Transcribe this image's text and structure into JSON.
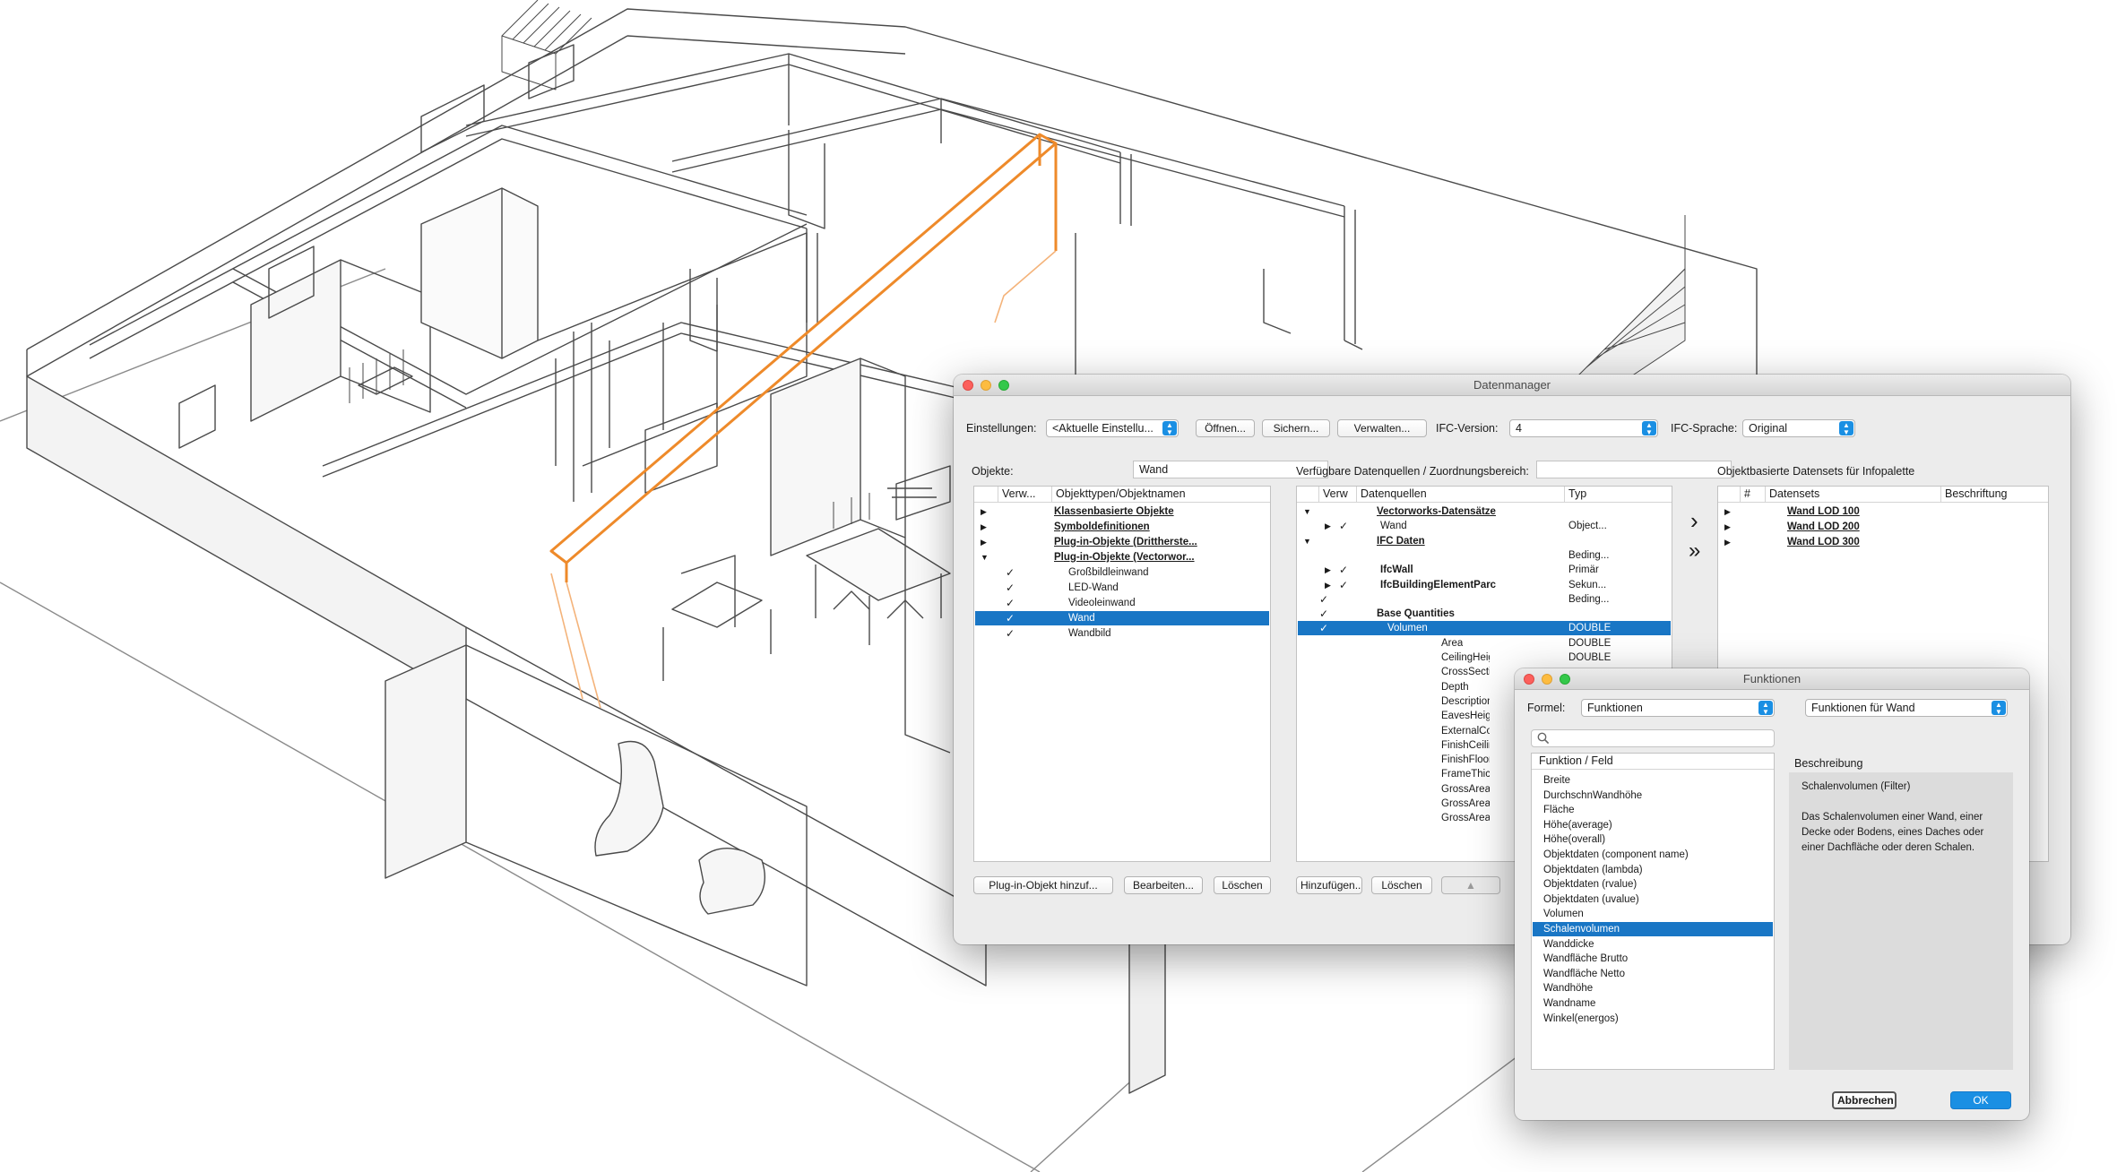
{
  "datenmanager": {
    "title": "Datenmanager",
    "einstellungen_label": "Einstellungen:",
    "einstellungen_value": "<Aktuelle Einstellu...",
    "oeffnen": "Öffnen...",
    "sichern": "Sichern...",
    "verwalten": "Verwalten...",
    "ifc_version_label": "IFC-Version:",
    "ifc_version_value": "4",
    "ifc_sprache_label": "IFC-Sprache:",
    "ifc_sprache_value": "Original",
    "objekte_label": "Objekte:",
    "objekte_filter": "Wand",
    "datenquellen_label": "Verfügbare Datenquellen / Zuordnungsbereich:",
    "datasets_label": "Objektbasierte Datensets für Infopalette",
    "objects_list": {
      "headers": [
        "Verw...",
        "Objekttypen/Objektnamen"
      ],
      "rows": [
        {
          "tri": "▶",
          "check": "",
          "name": "Klassenbasierte Objekte",
          "style": "u",
          "indent": 0
        },
        {
          "tri": "▶",
          "check": "",
          "name": "Symboldefinitionen",
          "style": "u",
          "indent": 0
        },
        {
          "tri": "▶",
          "check": "",
          "name": "Plug-in-Objekte (Drittherste...",
          "style": "u",
          "indent": 0
        },
        {
          "tri": "▼",
          "check": "",
          "name": "Plug-in-Objekte (Vectorwor...",
          "style": "u",
          "indent": 0
        },
        {
          "tri": "",
          "check": "✓",
          "name": "Großbildleinwand",
          "style": "",
          "indent": 1
        },
        {
          "tri": "",
          "check": "✓",
          "name": "LED-Wand",
          "style": "",
          "indent": 1
        },
        {
          "tri": "",
          "check": "✓",
          "name": "Videoleinwand",
          "style": "",
          "indent": 1
        },
        {
          "tri": "",
          "check": "✓",
          "name": "Wand",
          "style": "",
          "indent": 1,
          "selected": true
        },
        {
          "tri": "",
          "check": "✓",
          "name": "Wandbild",
          "style": "",
          "indent": 1
        }
      ]
    },
    "sources_list": {
      "headers": [
        "Verw",
        "Datenquellen",
        "Typ"
      ],
      "rows": [
        {
          "tri": "▼",
          "tri2": "",
          "check": "",
          "name": "Vectorworks-Datensätze",
          "style": "u",
          "type": "",
          "indent": 0
        },
        {
          "tri": "",
          "tri2": "▶",
          "check": "✓",
          "name": "Wand",
          "style": "",
          "type": "Object...",
          "indent": 1
        },
        {
          "tri": "▼",
          "tri2": "",
          "check": "",
          "name": "IFC Daten",
          "style": "u",
          "type": "",
          "indent": 0
        },
        {
          "tri": "",
          "tri2": "",
          "check": "",
          "name": "",
          "style": "",
          "type": "Beding...",
          "indent": 1
        },
        {
          "tri": "",
          "tri2": "▶",
          "check": "✓",
          "name": "IfcWall",
          "style": "b",
          "type": "Primär",
          "indent": 1
        },
        {
          "tri": "",
          "tri2": "▶",
          "check": "✓",
          "name": "IfcBuildingElementParc",
          "style": "b",
          "type": "Sekun...",
          "indent": 1
        },
        {
          "tri": "",
          "tri2": "",
          "check": "✓",
          "name": "",
          "style": "",
          "type": "Beding...",
          "indent": 1
        },
        {
          "tri": "",
          "tri2": "",
          "check": "✓",
          "name": "Base Quantities",
          "style": "b",
          "type": "",
          "indent": 2
        },
        {
          "tri": "",
          "tri2": "",
          "check": "✓",
          "name": "Volumen",
          "style": "",
          "type": "DOUBLE",
          "indent": 3,
          "selected": true
        },
        {
          "tri": "",
          "tri2": "",
          "check": "",
          "name": "Area",
          "style": "",
          "type": "DOUBLE",
          "indent": 4
        },
        {
          "tri": "",
          "tri2": "",
          "check": "",
          "name": "CeilingHeight",
          "style": "",
          "type": "DOUBLE",
          "indent": 4
        },
        {
          "tri": "",
          "tri2": "",
          "check": "",
          "name": "CrossSecti",
          "style": "",
          "type": "",
          "indent": 4
        },
        {
          "tri": "",
          "tri2": "",
          "check": "",
          "name": "Depth",
          "style": "",
          "type": "",
          "indent": 4
        },
        {
          "tri": "",
          "tri2": "",
          "check": "",
          "name": "Description",
          "style": "",
          "type": "",
          "indent": 4
        },
        {
          "tri": "",
          "tri2": "",
          "check": "",
          "name": "EavesHeig",
          "style": "",
          "type": "",
          "indent": 4
        },
        {
          "tri": "",
          "tri2": "",
          "check": "",
          "name": "ExternalCo",
          "style": "",
          "type": "",
          "indent": 4
        },
        {
          "tri": "",
          "tri2": "",
          "check": "",
          "name": "FinishCeilin",
          "style": "",
          "type": "",
          "indent": 4
        },
        {
          "tri": "",
          "tri2": "",
          "check": "",
          "name": "FinishFloor",
          "style": "",
          "type": "",
          "indent": 4
        },
        {
          "tri": "",
          "tri2": "",
          "check": "",
          "name": "FrameThicl",
          "style": "",
          "type": "",
          "indent": 4
        },
        {
          "tri": "",
          "tri2": "",
          "check": "",
          "name": "GrossArea",
          "style": "",
          "type": "",
          "indent": 4
        },
        {
          "tri": "",
          "tri2": "",
          "check": "",
          "name": "GrossArea",
          "style": "",
          "type": "",
          "indent": 4
        },
        {
          "tri": "",
          "tri2": "",
          "check": "",
          "name": "GrossArea",
          "style": "",
          "type": "",
          "indent": 4
        }
      ]
    },
    "datasets_list": {
      "headers": [
        "#",
        "Datensets",
        "Beschriftung"
      ],
      "rows": [
        {
          "tri": "▶",
          "name": "Wand LOD 100"
        },
        {
          "tri": "▶",
          "name": "Wand LOD 200"
        },
        {
          "tri": "▶",
          "name": "Wand LOD 300"
        }
      ]
    },
    "move_right": "›",
    "move_all_right": "»",
    "btn_plugin_add": "Plug-in-Objekt hinzuf...",
    "btn_bearbeiten": "Bearbeiten...",
    "btn_loeschen1": "Löschen",
    "btn_hinzufuegen": "Hinzufügen...",
    "btn_loeschen2": "Löschen",
    "btn_up": "▲"
  },
  "funktionen": {
    "title": "Funktionen",
    "formel_label": "Formel:",
    "formel_value": "Funktionen",
    "filter_value": "Funktionen für Wand",
    "search_placeholder": "",
    "list_header": "Funktion / Feld",
    "items": [
      "Breite",
      "DurchschnWandhöhe",
      "Fläche",
      "Höhe(average)",
      "Höhe(overall)",
      "Objektdaten (component name)",
      "Objektdaten (lambda)",
      "Objektdaten (rvalue)",
      "Objektdaten (uvalue)",
      "Volumen",
      "Schalenvolumen",
      "Wanddicke",
      "Wandfläche Brutto",
      "Wandfläche Netto",
      "Wandhöhe",
      "Wandname",
      "Winkel(energos)"
    ],
    "selected_index": 10,
    "beschreibung_label": "Beschreibung",
    "beschreibung_title": "Schalenvolumen (Filter)",
    "beschreibung_text": "Das Schalenvolumen einer Wand, einer Decke oder Bodens, eines Daches oder einer Dachfläche oder deren Schalen.",
    "abbrechen": "Abbrechen",
    "ok": "OK"
  },
  "colors": {
    "accent": "#1a8fe3",
    "selection": "#1976c5",
    "highlight_wall": "#ee8a2a"
  }
}
